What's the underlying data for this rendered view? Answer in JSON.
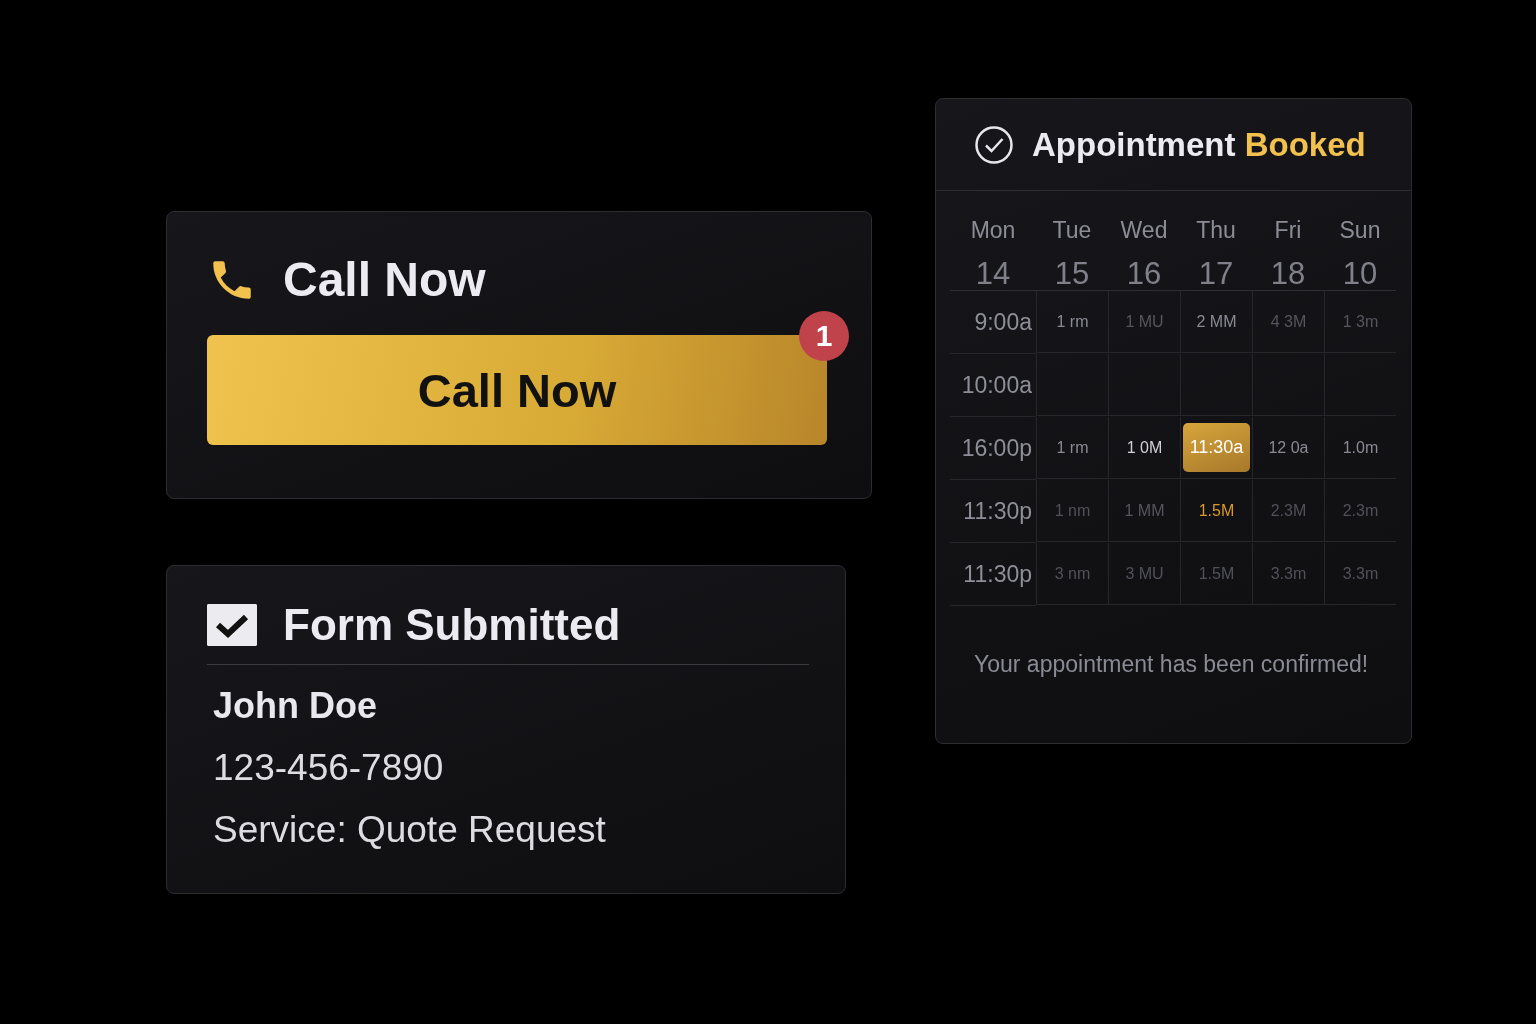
{
  "call_card": {
    "title": "Call Now",
    "button": {
      "label": "Call Now",
      "badge": "1"
    }
  },
  "form_card": {
    "title": "Form Submitted",
    "checked": true,
    "lines": [
      {
        "text": "John Doe",
        "kind": "name"
      },
      {
        "text": "123-456-7890",
        "kind": "detail"
      },
      {
        "text": "Service: Quote Request",
        "kind": "detail"
      }
    ]
  },
  "appointment_card": {
    "title": "Appointment",
    "title_accent": "Booked",
    "days": [
      {
        "name": "Mon",
        "date": "14"
      },
      {
        "name": "Tue",
        "date": "15"
      },
      {
        "name": "Wed",
        "date": "16"
      },
      {
        "name": "Thu",
        "date": "17"
      },
      {
        "name": "Fri",
        "date": "18"
      },
      {
        "name": "Sun",
        "date": "10"
      }
    ],
    "rows": [
      {
        "time": "9:00a",
        "cells": [
          {
            "text": "1 rm",
            "kind": "normal"
          },
          {
            "text": "1 MU",
            "kind": "dim"
          },
          {
            "text": "2 MM",
            "kind": "normal"
          },
          {
            "text": "4 3M",
            "kind": "dim"
          },
          {
            "text": "1 3m",
            "kind": "dim"
          }
        ]
      },
      {
        "time": "10:00a",
        "cells": [
          {
            "kind": "empty"
          },
          {
            "kind": "empty"
          },
          {
            "kind": "empty"
          },
          {
            "kind": "empty"
          },
          {
            "kind": "empty"
          }
        ]
      },
      {
        "time": "16:00p",
        "cells": [
          {
            "text": "1 rm",
            "kind": "normal"
          },
          {
            "text": "1 0M",
            "kind": "bright"
          },
          {
            "text": "11:30a",
            "kind": "selected"
          },
          {
            "text": "12 0a",
            "kind": "normal"
          },
          {
            "text": "1.0m",
            "kind": "normal"
          }
        ]
      },
      {
        "time": "11:30p",
        "cells": [
          {
            "text": "1 nm",
            "kind": "faint"
          },
          {
            "text": "1 MM",
            "kind": "dim"
          },
          {
            "text": "1.5M",
            "kind": "accent"
          },
          {
            "text": "2.3M",
            "kind": "faint"
          },
          {
            "text": "2.3m",
            "kind": "faint"
          }
        ]
      },
      {
        "time": "11:30p",
        "cells": [
          {
            "text": "3 nm",
            "kind": "faint"
          },
          {
            "text": "3 MU",
            "kind": "faint"
          },
          {
            "text": "1.5M",
            "kind": "faint"
          },
          {
            "text": "3.3m",
            "kind": "faint"
          },
          {
            "text": "3.3m",
            "kind": "faint"
          }
        ]
      }
    ],
    "footer": "Your appointment has been confirmed!"
  }
}
